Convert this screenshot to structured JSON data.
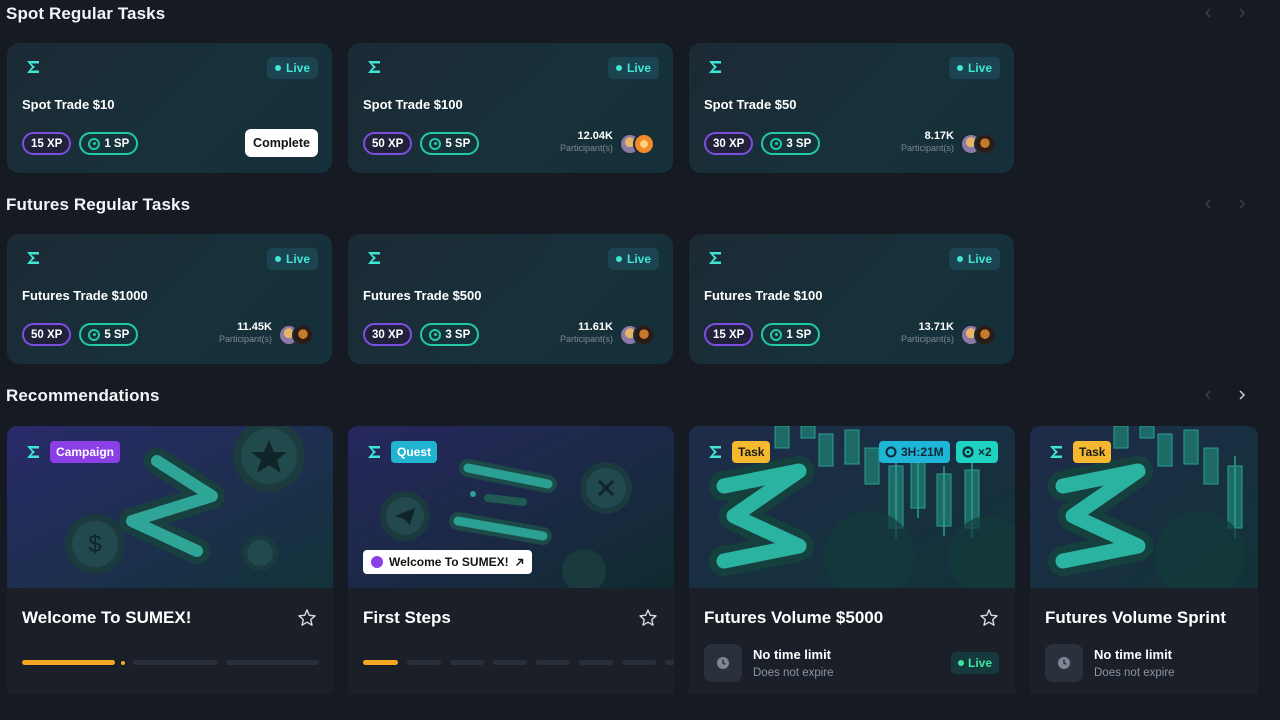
{
  "sections": {
    "spot_title": "Spot Regular Tasks",
    "futures_title": "Futures Regular Tasks",
    "recommendations_title": "Recommendations"
  },
  "spot_tasks": [
    {
      "name": "Spot Trade $10",
      "status": "Live",
      "xp": "15 XP",
      "sp": "1 SP",
      "action": "Complete"
    },
    {
      "name": "Spot Trade $100",
      "status": "Live",
      "xp": "50 XP",
      "sp": "5 SP",
      "participants": "12.04K",
      "participants_label": "Participant(s)"
    },
    {
      "name": "Spot Trade $50",
      "status": "Live",
      "xp": "30 XP",
      "sp": "3 SP",
      "participants": "8.17K",
      "participants_label": "Participant(s)"
    }
  ],
  "futures_tasks": [
    {
      "name": "Futures Trade $1000",
      "status": "Live",
      "xp": "50 XP",
      "sp": "5 SP",
      "participants": "11.45K",
      "participants_label": "Participant(s)"
    },
    {
      "name": "Futures Trade $500",
      "status": "Live",
      "xp": "30 XP",
      "sp": "3 SP",
      "participants": "11.61K",
      "participants_label": "Participant(s)"
    },
    {
      "name": "Futures Trade $100",
      "status": "Live",
      "xp": "15 XP",
      "sp": "1 SP",
      "participants": "13.71K",
      "participants_label": "Participant(s)"
    }
  ],
  "recommendations": [
    {
      "tag": "Campaign",
      "title": "Welcome To SUMEX!",
      "progress_steps_done": 1,
      "progress_steps_total": 3
    },
    {
      "tag": "Quest",
      "title": "First Steps",
      "link_label": "Welcome To SUMEX!",
      "progress_steps_done": 1,
      "progress_steps_total": 8
    },
    {
      "tag": "Task",
      "title": "Futures Volume $5000",
      "timer": "3H:21M",
      "multiplier": "×2",
      "time_title": "No time limit",
      "time_sub": "Does not expire",
      "status": "Live"
    },
    {
      "tag": "Task",
      "title": "Futures Volume Sprint",
      "time_title": "No time limit",
      "time_sub": "Does not expire"
    }
  ],
  "colors": {
    "background": "#151a23",
    "accent_teal": "#3fe6d4",
    "xp_purple": "#7b4fe0",
    "sp_green": "#22c9a8",
    "progress_orange": "#f5a623",
    "tag_task": "#f5b82e"
  },
  "icons": {
    "brand": "sigma-icon",
    "favorite": "star-icon",
    "clock": "clock-icon",
    "external": "arrow-up-right-icon",
    "nav_prev": "chevron-left-icon",
    "nav_next": "chevron-right-icon"
  }
}
